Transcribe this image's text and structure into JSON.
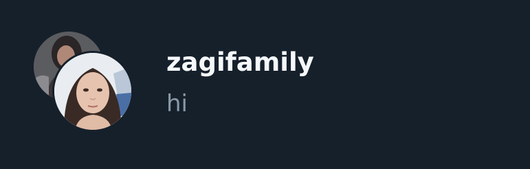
{
  "conversation": {
    "username": "zagifamily",
    "last_message": "hi"
  },
  "avatars": {
    "back_icon": "group-member-photo",
    "front_icon": "user-portrait-photo"
  },
  "colors": {
    "background": "#16202b",
    "username_text": "#f5f8fa",
    "message_text": "#8a99a8"
  }
}
